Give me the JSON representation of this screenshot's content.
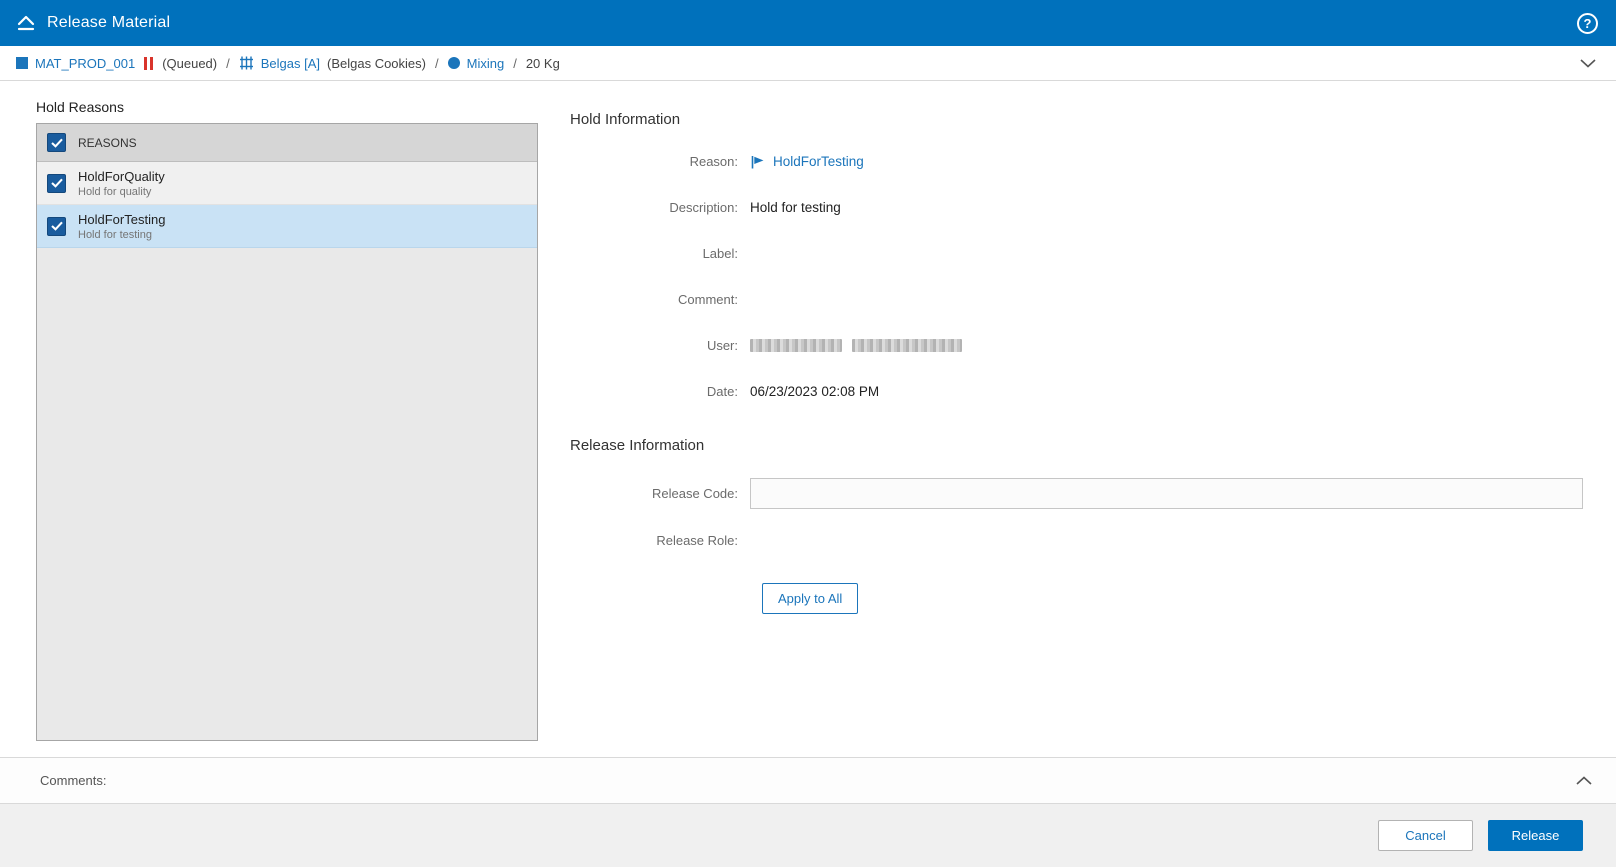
{
  "colors": {
    "accent": "#0071bc",
    "link": "#1b75bb",
    "checkbox": "#1a5c9e",
    "hold_red": "#d9342b",
    "selected_row": "#c9e2f5"
  },
  "header": {
    "title": "Release Material",
    "help_glyph": "?"
  },
  "breadcrumb": {
    "material": "MAT_PROD_001",
    "status": "(Queued)",
    "separator": "/",
    "equipment": "Belgas [A]",
    "equipment_desc": "(Belgas Cookies)",
    "operation": "Mixing",
    "quantity": "20 Kg"
  },
  "hold_reasons": {
    "title": "Hold Reasons",
    "header_label": "REASONS",
    "header_checked": true,
    "items": [
      {
        "name": "HoldForQuality",
        "desc": "Hold for quality",
        "checked": true,
        "selected": false
      },
      {
        "name": "HoldForTesting",
        "desc": "Hold for testing",
        "checked": true,
        "selected": true
      }
    ]
  },
  "hold_information": {
    "title": "Hold Information",
    "fields": [
      {
        "label": "Reason:",
        "value": "HoldForTesting"
      },
      {
        "label": "Description:",
        "value": "Hold for testing"
      },
      {
        "label": "Label:",
        "value": ""
      },
      {
        "label": "Comment:",
        "value": ""
      },
      {
        "label": "User:",
        "value": "",
        "redacted": true
      },
      {
        "label": "Date:",
        "value": "06/23/2023 02:08 PM"
      }
    ]
  },
  "release_information": {
    "title": "Release Information",
    "code_label": "Release Code:",
    "code_value": "",
    "role_label": "Release Role:",
    "role_value": "",
    "apply_label": "Apply to All"
  },
  "comments": {
    "label": "Comments:"
  },
  "footer": {
    "cancel_label": "Cancel",
    "release_label": "Release"
  }
}
